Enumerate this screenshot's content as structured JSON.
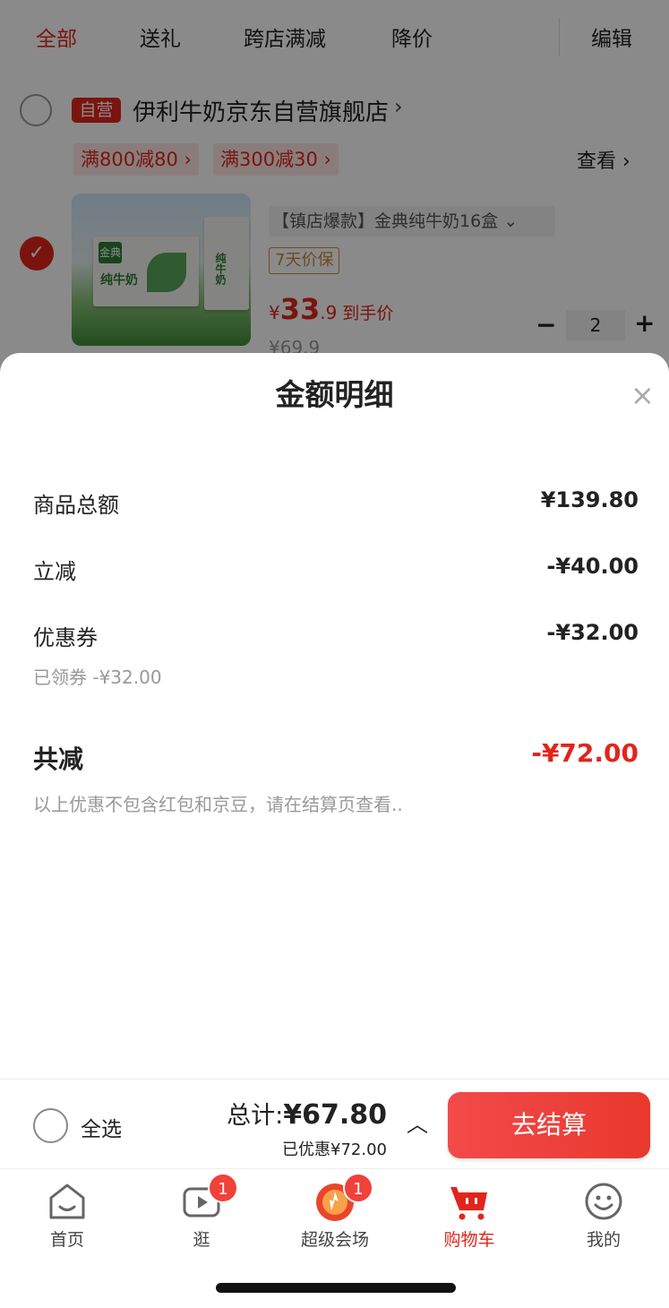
{
  "top_tabs": [
    {
      "label": "全部",
      "active": true
    },
    {
      "label": "送礼",
      "active": false
    },
    {
      "label": "跨店满减",
      "active": false
    },
    {
      "label": "降价",
      "active": false
    }
  ],
  "edit_label": "编辑",
  "store": {
    "badge": "自营",
    "name": "伊利牛奶京东自营旗舰店",
    "arrow": "›"
  },
  "promotions": [
    "满800减80 ›",
    "满300减30 ›"
  ],
  "view_link": "查看 ›",
  "product": {
    "title": "【镇店爆款】金典纯牛奶16盒  ⌄",
    "guarantee": "7天价保",
    "price_symbol": "¥",
    "price_int": "33",
    "price_dec": ".9",
    "price_tag": "到手价",
    "old_price": "¥69.9",
    "quantity": "2",
    "image_brand": "金典",
    "image_text": "纯牛奶"
  },
  "sheet": {
    "title": "金额明细",
    "close": "×",
    "rows": [
      {
        "label": "商品总额",
        "value": "¥139.80"
      },
      {
        "label": "立减",
        "value": "-¥40.00"
      },
      {
        "label": "优惠券",
        "value": "-¥32.00"
      }
    ],
    "coupon_note": "已领券 -¥32.00",
    "total_label": "共减",
    "total_value": "-¥72.00",
    "disclaimer": "以上优惠不包含红包和京豆，请在结算页查看.."
  },
  "checkout": {
    "select_all": "全选",
    "total_label": "总计:",
    "total_amount": "¥67.80",
    "saved": "已优惠¥72.00",
    "expand_icon": "︿",
    "button": "去结算"
  },
  "tabbar": [
    {
      "label": "首页",
      "icon": "home-icon",
      "badge": null,
      "active": false
    },
    {
      "label": "逛",
      "icon": "video-icon",
      "badge": "1",
      "active": false
    },
    {
      "label": "超级会场",
      "icon": "venue-icon",
      "badge": "1",
      "active": false
    },
    {
      "label": "购物车",
      "icon": "cart-icon",
      "badge": null,
      "active": true
    },
    {
      "label": "我的",
      "icon": "profile-icon",
      "badge": null,
      "active": false
    }
  ],
  "colors": {
    "accent": "#e1251b",
    "muted": "#999999"
  }
}
